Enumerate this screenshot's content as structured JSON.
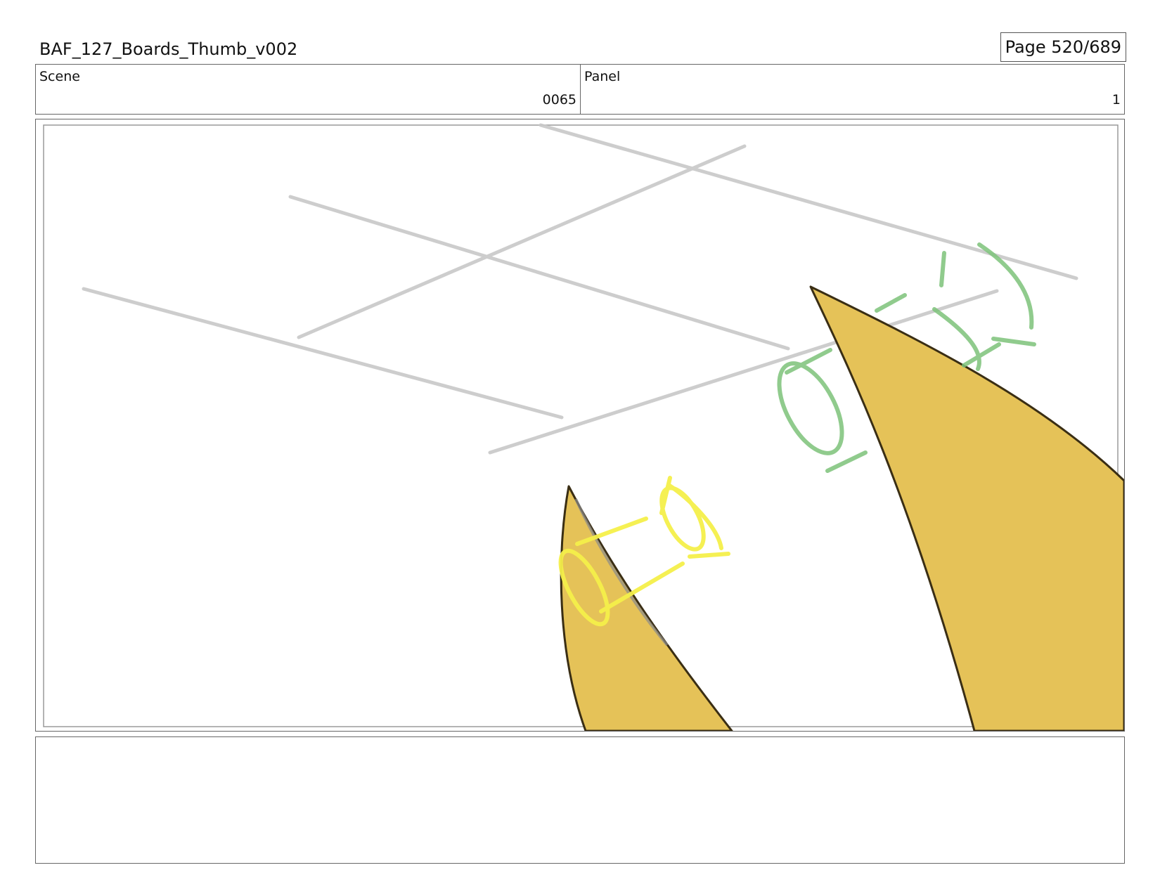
{
  "header": {
    "title": "BAF_127_Boards_Thumb_v002",
    "page_label": "Page 520/689"
  },
  "info": {
    "scene_label": "Scene",
    "scene_value": "0065",
    "panel_label": "Panel",
    "panel_value": "1"
  },
  "notes": {
    "text": ""
  },
  "colors": {
    "fill_orange": "#E5C258",
    "sketch_gray": "#C8C8C8",
    "sketch_green": "#7DC37A",
    "sketch_yellow": "#F5F04A",
    "outline_dark": "#3A2E14"
  }
}
